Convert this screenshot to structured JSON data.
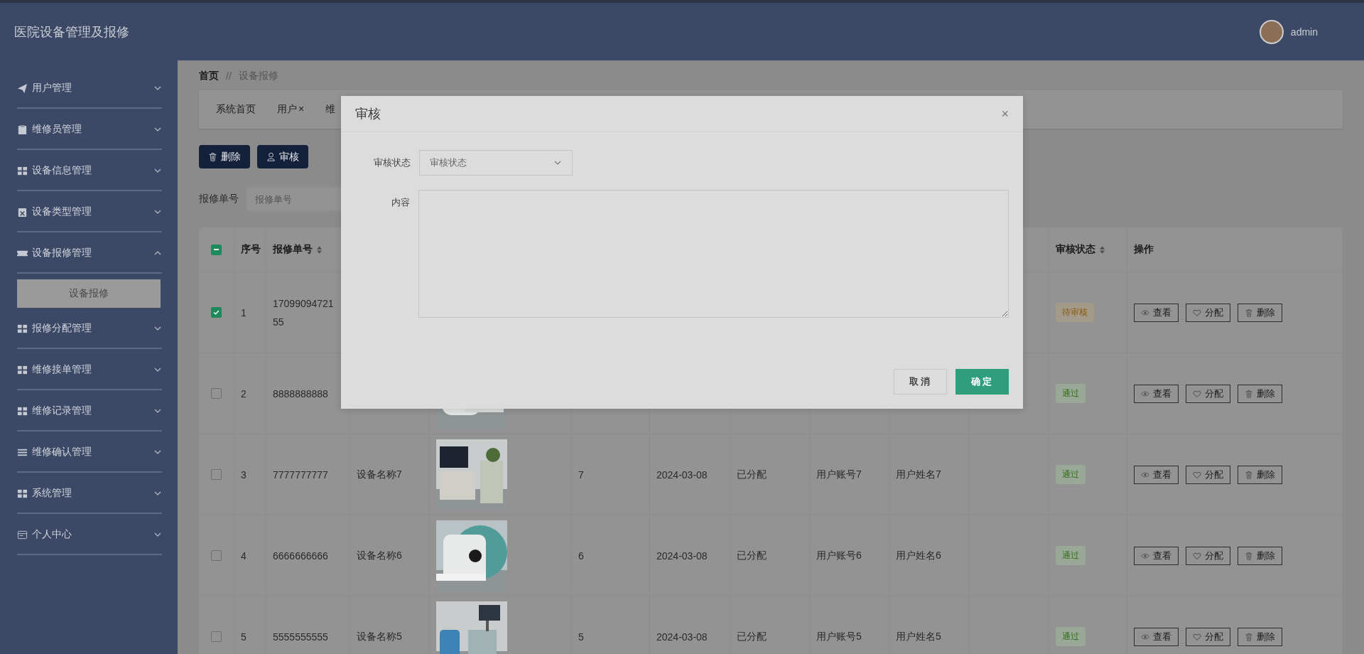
{
  "header": {
    "title": "医院设备管理及报修",
    "user": "admin"
  },
  "sidebar": {
    "items": [
      {
        "label": "用户管理",
        "expanded": false
      },
      {
        "label": "维修员管理",
        "expanded": false
      },
      {
        "label": "设备信息管理",
        "expanded": false
      },
      {
        "label": "设备类型管理",
        "expanded": false
      },
      {
        "label": "设备报修管理",
        "expanded": true,
        "children": [
          {
            "label": "设备报修",
            "selected": true
          }
        ]
      },
      {
        "label": "报修分配管理",
        "expanded": false
      },
      {
        "label": "维修接单管理",
        "expanded": false
      },
      {
        "label": "维修记录管理",
        "expanded": false
      },
      {
        "label": "维修确认管理",
        "expanded": false
      },
      {
        "label": "系统管理",
        "expanded": false
      },
      {
        "label": "个人中心",
        "expanded": false
      }
    ]
  },
  "breadcrumb": {
    "items": [
      "首页",
      "设备报修"
    ],
    "separator": "//"
  },
  "tabs": [
    {
      "label": "系统首页"
    },
    {
      "label": "用户",
      "close": "×"
    },
    {
      "label": "维"
    }
  ],
  "toolbar": {
    "buttons": [
      "删除",
      "审核"
    ]
  },
  "search": {
    "fields": [
      {
        "label": "报修单号",
        "placeholder": "报修单号"
      }
    ]
  },
  "table": {
    "select_all_partial": true,
    "columns": [
      {
        "label": "序号",
        "sortable": false
      },
      {
        "label": "报修单号",
        "sortable": true
      },
      {
        "label": "审核状态",
        "sortable": true
      },
      {
        "label": "操作",
        "sortable": false
      }
    ],
    "rows": [
      {
        "checked": true,
        "no": "1",
        "order_no": "1709909472155",
        "status": {
          "text": "待审核",
          "kind": "pending"
        },
        "actions": [
          "查看",
          "分配",
          "删除"
        ]
      },
      {
        "checked": false,
        "no": "2",
        "order_no": "8888888888",
        "photo": {
          "kind": "picture"
        },
        "status": {
          "text": "通过",
          "kind": "passed"
        },
        "actions": [
          "查看",
          "分配",
          "删除"
        ]
      },
      {
        "checked": false,
        "no": "3",
        "order_no": "7777777777",
        "device": "设备名称7",
        "photo": {
          "kind": "picture"
        },
        "qty": "7",
        "time": "2024-03-08",
        "assign": "已分配",
        "account": "用户账号7",
        "name": "用户姓名7",
        "status": {
          "text": "通过",
          "kind": "passed"
        },
        "actions": [
          "查看",
          "分配",
          "删除"
        ]
      },
      {
        "checked": false,
        "no": "4",
        "order_no": "6666666666",
        "device": "设备名称6",
        "photo": {
          "kind": "picture"
        },
        "qty": "6",
        "time": "2024-03-08",
        "assign": "已分配",
        "account": "用户账号6",
        "name": "用户姓名6",
        "status": {
          "text": "通过",
          "kind": "passed"
        },
        "actions": [
          "查看",
          "分配",
          "删除"
        ]
      },
      {
        "checked": false,
        "no": "5",
        "order_no": "5555555555",
        "device": "设备名称5",
        "photo": {
          "kind": "picture"
        },
        "qty": "5",
        "time": "2024-03-08",
        "assign": "已分配",
        "account": "用户账号5",
        "name": "用户姓名5",
        "status": {
          "text": "通过",
          "kind": "passed"
        },
        "actions": [
          "查看",
          "分配",
          "删除"
        ]
      }
    ]
  },
  "dialog": {
    "title": "审核",
    "close": "×",
    "fields": [
      {
        "label": "审核状态",
        "kind": "select",
        "placeholder": "审核状态"
      },
      {
        "label": "内容",
        "kind": "textarea"
      }
    ],
    "buttons": [
      {
        "label": "取消",
        "kind": "default"
      },
      {
        "label": "确定",
        "kind": "primary"
      }
    ]
  }
}
